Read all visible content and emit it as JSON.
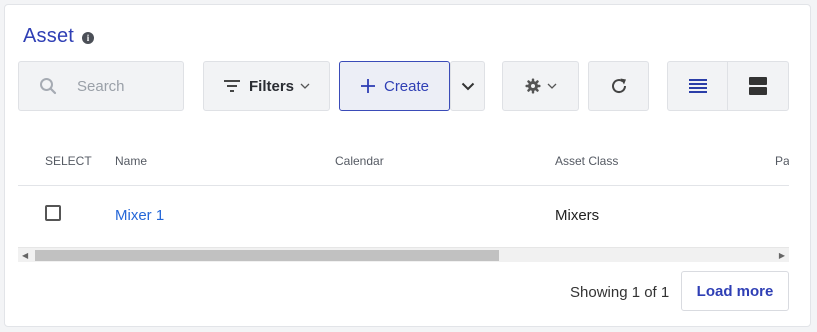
{
  "header": {
    "title": "Asset",
    "info_icon": "info-icon"
  },
  "toolbar": {
    "search_placeholder": "Search",
    "filters_label": "Filters",
    "create_label": "Create"
  },
  "table": {
    "columns": [
      "SELECT",
      "Name",
      "Calendar",
      "Asset Class",
      "Pa"
    ],
    "rows": [
      {
        "selected": false,
        "name": "Mixer 1",
        "calendar": "",
        "asset_class": "Mixers"
      }
    ],
    "scroll_fraction_visible": 0.63
  },
  "footer": {
    "showing": "Showing 1 of 1",
    "load_more_label": "Load more"
  },
  "colors": {
    "accent": "#2f3fb5",
    "link": "#2567d8"
  }
}
